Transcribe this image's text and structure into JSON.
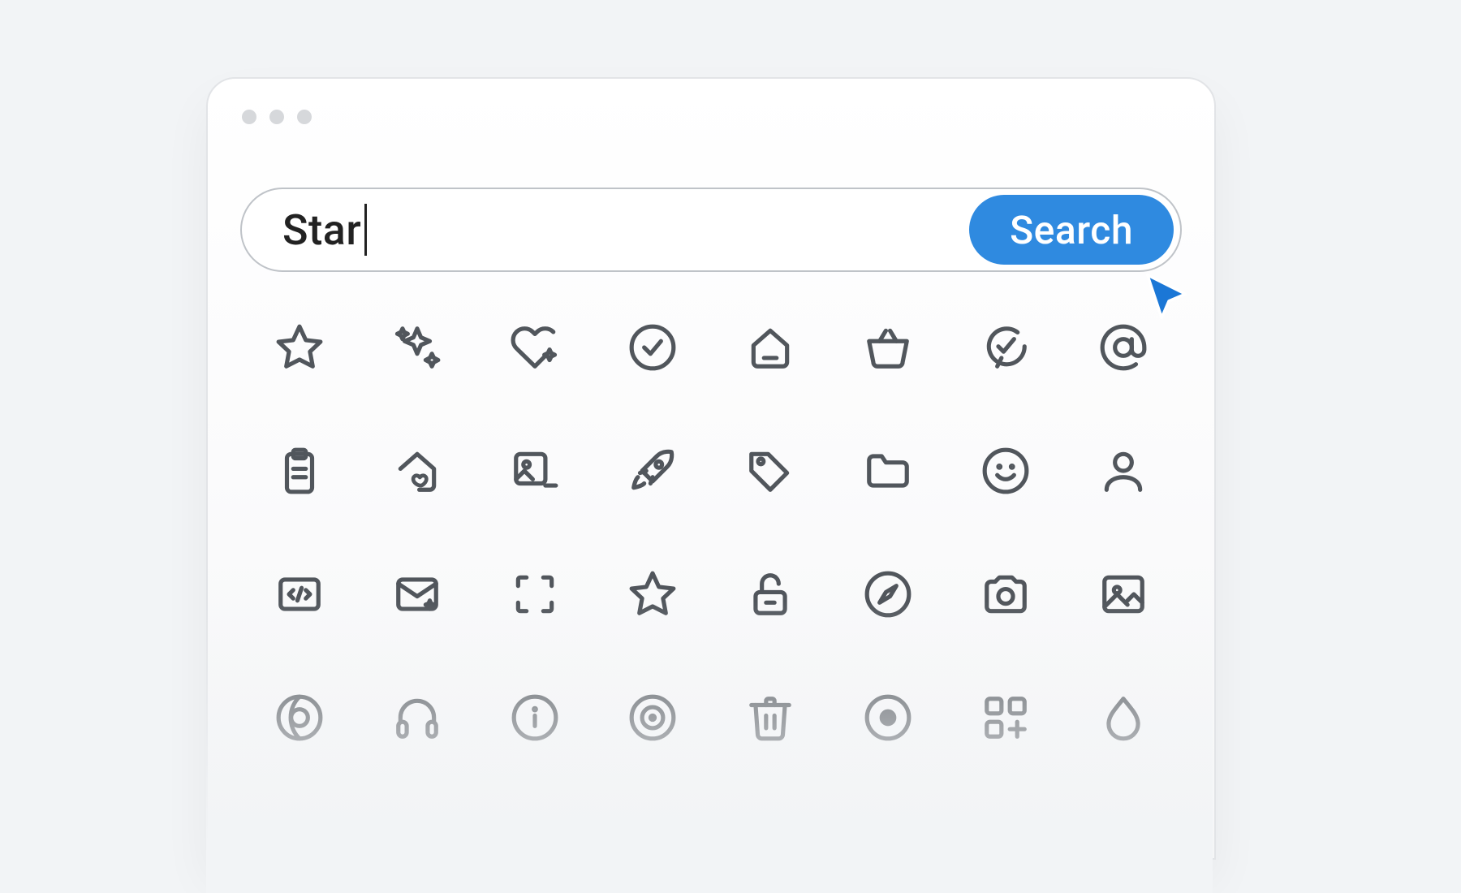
{
  "search": {
    "value": "Star",
    "button_label": "Search"
  },
  "icons": [
    [
      "star-icon",
      "sparkles-icon",
      "heart-sparkle-icon",
      "check-circle-icon",
      "home-icon",
      "basket-icon",
      "chat-check-icon",
      "at-sign-icon"
    ],
    [
      "clipboard-icon",
      "house-heart-icon",
      "image-minus-icon",
      "rocket-icon",
      "tag-icon",
      "folder-icon",
      "smiley-icon",
      "user-icon"
    ],
    [
      "code-box-icon",
      "mail-sparkle-icon",
      "scan-icon",
      "star-outline-icon",
      "unlock-icon",
      "compass-icon",
      "camera-icon",
      "image-icon"
    ],
    [
      "globe-icon",
      "headphones-icon",
      "info-icon",
      "target-icon",
      "trash-icon",
      "record-icon",
      "apps-add-icon",
      "droplet-icon"
    ]
  ]
}
